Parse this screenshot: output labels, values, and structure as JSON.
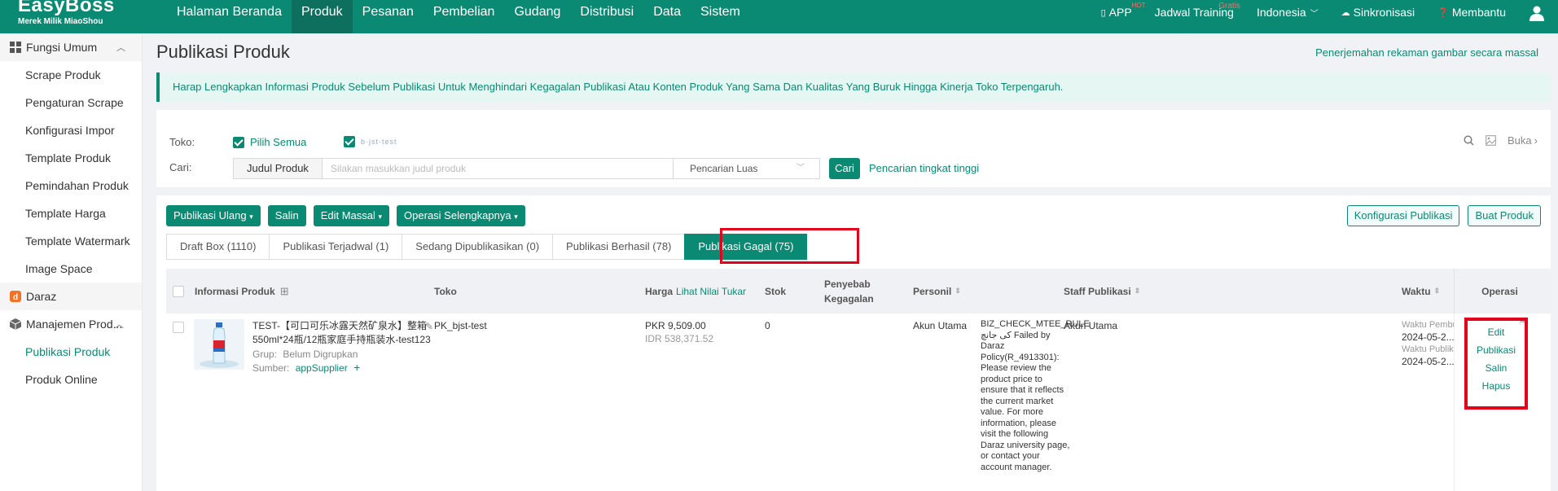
{
  "brand": {
    "name": "EasyBoss",
    "tagline": "Merek Milik MiaoShou"
  },
  "topnav": {
    "menu": [
      "Halaman Beranda",
      "Produk",
      "Pesanan",
      "Pembelian",
      "Gudang",
      "Distribusi",
      "Data",
      "Sistem"
    ],
    "active_menu": "Produk",
    "app": "APP",
    "app_badge": "HOT",
    "training": "Jadwal Training",
    "training_badge": "Gratis",
    "language": "Indonesia",
    "sync": "Sinkronisasi",
    "help": "Membantu"
  },
  "sidebar": {
    "group1": "Fungsi Umum",
    "items1": [
      "Scrape Produk",
      "Pengaturan Scrape",
      "Konfigurasi Impor",
      "Template Produk",
      "Pemindahan Produk",
      "Template Harga",
      "Template Watermark",
      "Image Space"
    ],
    "group2": "Daraz",
    "group3": "Manajemen Prod...",
    "items3": [
      "Publikasi Produk",
      "Produk Online"
    ]
  },
  "page": {
    "title": "Publikasi Produk",
    "translate_link": "Penerjemahan rekaman gambar secara massal",
    "notice": "Harap Lengkapkan Informasi Produk Sebelum Publikasi Untuk Menghindari Kegagalan Publikasi Atau Konten Produk Yang Sama Dan Kualitas Yang Buruk Hingga Kinerja Toko Terpengaruh."
  },
  "filter": {
    "store_label": "Toko:",
    "select_all": "Pilih Semua",
    "store_name": "b·jst·test",
    "search_label": "Cari:",
    "search_type": "Judul Produk",
    "search_placeholder": "Silakan masukkan judul produk",
    "search_mode": "Pencarian Luas",
    "search_button": "Cari",
    "advanced": "Pencarian tingkat tinggi",
    "open": "Buka"
  },
  "toolbar": {
    "actions": [
      "Publikasi Ulang",
      "Salin",
      "Edit Massal",
      "Operasi Selengkapnya"
    ],
    "config": "Konfigurasi Publikasi",
    "create": "Buat Produk"
  },
  "tabs": [
    "Draft Box (1110)",
    "Publikasi Terjadwal (1)",
    "Sedang Dipublikasikan (0)",
    "Publikasi Berhasil (78)",
    "Publikasi Gagal (75)"
  ],
  "active_tab": "Publikasi Gagal (75)",
  "table": {
    "headers": {
      "info": "Informasi Produk",
      "store": "Toko",
      "price": "Harga",
      "price_link": "Lihat Nilai Tukar",
      "stock": "Stok",
      "reason": "Penyebab Kegagalan",
      "personnel": "Personil",
      "staff": "Staff Publikasi",
      "time": "Waktu",
      "ops": "Operasi"
    },
    "rows": [
      {
        "title": "TEST-【可口可乐冰露天然矿泉水】整箱550ml*24瓶/12瓶家庭手持瓶装水-test123",
        "group_label": "Grup:",
        "group": "Belum Digrupkan",
        "source_label": "Sumber:",
        "source": "appSupplier",
        "store": "PK_bjst-test",
        "price_pkr": "PKR 9,509.00",
        "price_idr": "IDR 538,371.52",
        "stock": "0",
        "reason": "BIZ_CHECK_MTEE_RULE کی جانچ Failed by Daraz Policy(R_4913301): Please review the product price to ensure that it reflects the current market value. For more information, please visit the following Daraz university page, or contact your account manager.",
        "personnel": "Akun Utama",
        "staff": "Akun Utama",
        "time_created_label": "Waktu Pembuatan",
        "time_created": "2024-05-2...",
        "time_published_label": "Waktu Publikasi",
        "time_published": "2024-05-2...",
        "ops": [
          "Edit",
          "Publikasi",
          "Salin",
          "Hapus"
        ]
      }
    ]
  },
  "colors": {
    "brand": "#0a8a72",
    "highlight": "#e3001b"
  }
}
